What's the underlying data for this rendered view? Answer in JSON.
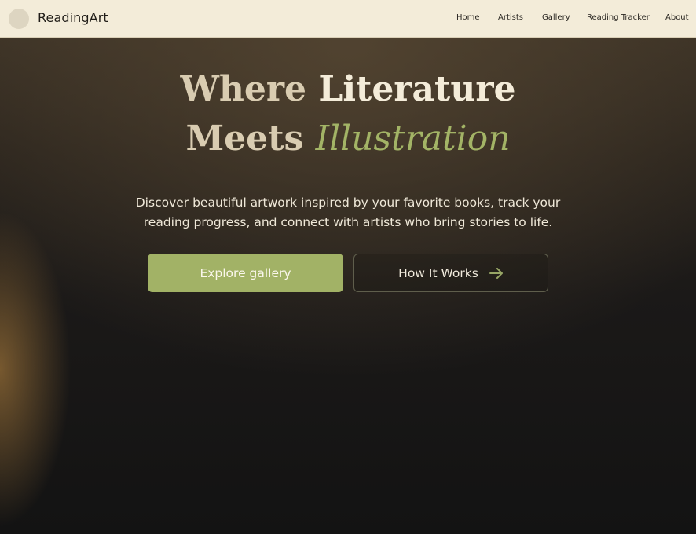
{
  "header": {
    "brand": "ReadingArt",
    "nav": {
      "home": "Home",
      "artists": "Artists",
      "gallery": "Gallery",
      "reading_tracker": "Reading Tracker",
      "about": "About"
    }
  },
  "hero": {
    "title_line1_part1": "Where",
    "title_line1_part2": "Literature",
    "title_line2_part1": "Meets",
    "title_line2_accent": "Illustration",
    "subtitle_line1": "Discover beautiful artwork inspired by your favorite books, track your",
    "subtitle_line2": "reading progress, and connect with artists who bring stories to life.",
    "primary_cta": "Explore gallery",
    "secondary_cta": "How It Works",
    "secondary_cta_icon": "arrow-right-icon"
  },
  "colors": {
    "header_bg": "#f3ecd9",
    "accent": "#a2b266",
    "heading_light": "#f4ecd9",
    "heading_muted": "#d9ccb1"
  }
}
